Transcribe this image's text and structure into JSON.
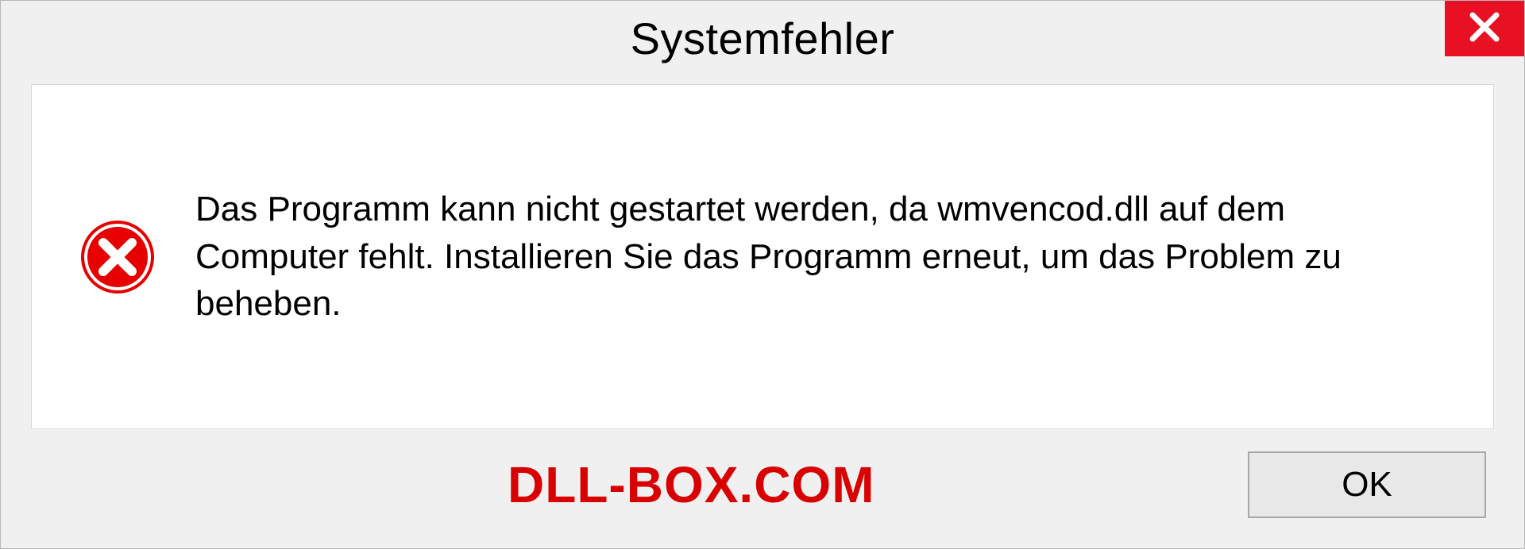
{
  "titlebar": {
    "title": "Systemfehler"
  },
  "message": {
    "text": "Das Programm kann nicht gestartet werden, da wmvencod.dll auf dem Computer fehlt. Installieren Sie das Programm erneut, um das Problem zu beheben."
  },
  "footer": {
    "watermark": "DLL-BOX.COM",
    "ok_label": "OK"
  }
}
